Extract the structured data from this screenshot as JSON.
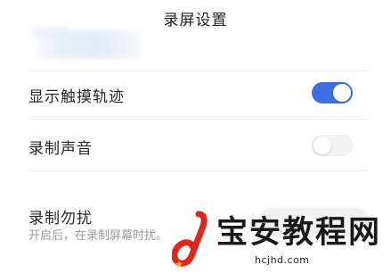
{
  "header": {
    "title": "录屏设置"
  },
  "settings": [
    {
      "label": "显示触摸轨迹",
      "enabled": true
    },
    {
      "label": "录制声音",
      "enabled": false
    },
    {
      "label": "录制勿扰",
      "description": "开启后，在录制屏幕时扰。"
    }
  ],
  "colors": {
    "toggle_on": "#3e6fe0",
    "toggle_off": "#f4f4f4",
    "watermark_red": "#e0261b"
  },
  "watermark": {
    "title": "宝安教程网",
    "url": "hcjhd.com"
  }
}
